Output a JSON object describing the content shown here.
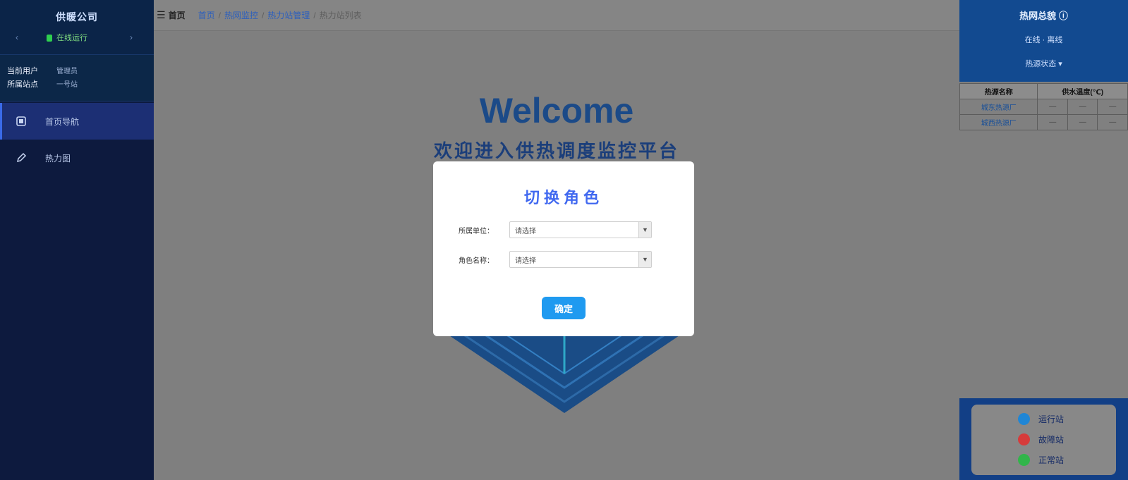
{
  "sidebar": {
    "title": "供暖公司",
    "status": "在线运行",
    "info": [
      {
        "key": "当前用户",
        "value": "管理员"
      },
      {
        "key": "所属站点",
        "value": "一号站"
      }
    ],
    "items": [
      {
        "label": "首页导航",
        "icon": "home-icon",
        "active": true
      },
      {
        "label": "热力图",
        "icon": "pencil-icon",
        "active": false
      }
    ]
  },
  "topbar": {
    "title": "首页",
    "breadcrumbs": [
      "首页",
      "热网监控",
      "热力站管理",
      "热力站列表"
    ]
  },
  "main": {
    "welcome": "Welcome",
    "subtitle": "欢迎进入供热调度监控平台"
  },
  "right_panel": {
    "title": "热网总貌",
    "line2": "在线 · 离线",
    "line3": "热源状态",
    "table": {
      "headers": [
        "热源名称",
        "供水温度(℃)"
      ],
      "rows": [
        [
          "城东热源厂",
          "—",
          "—",
          "—"
        ],
        [
          "城西热源厂",
          "—",
          "—",
          "—"
        ]
      ]
    },
    "legend": [
      {
        "label": "运行站",
        "color": "#1f86d6"
      },
      {
        "label": "故障站",
        "color": "#d63b3b"
      },
      {
        "label": "正常站",
        "color": "#31b54a"
      }
    ]
  },
  "modal": {
    "title": "切换角色",
    "fields": [
      {
        "label": "所属单位：",
        "value": "请选择"
      },
      {
        "label": "角色名称：",
        "value": "请选择"
      }
    ],
    "confirm_label": "确定"
  },
  "colors": {
    "sidebar_bg": "#0d1a3e",
    "accent_blue": "#1f9af0",
    "modal_title": "#4169f0",
    "overlay": "#7f7f7f"
  }
}
